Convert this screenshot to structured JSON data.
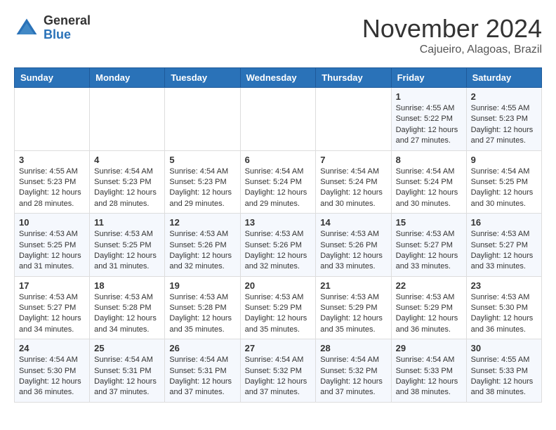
{
  "logo": {
    "general": "General",
    "blue": "Blue"
  },
  "title": "November 2024",
  "location": "Cajueiro, Alagoas, Brazil",
  "days_of_week": [
    "Sunday",
    "Monday",
    "Tuesday",
    "Wednesday",
    "Thursday",
    "Friday",
    "Saturday"
  ],
  "weeks": [
    [
      {
        "day": "",
        "content": ""
      },
      {
        "day": "",
        "content": ""
      },
      {
        "day": "",
        "content": ""
      },
      {
        "day": "",
        "content": ""
      },
      {
        "day": "",
        "content": ""
      },
      {
        "day": "1",
        "content": "Sunrise: 4:55 AM\nSunset: 5:22 PM\nDaylight: 12 hours and 27 minutes."
      },
      {
        "day": "2",
        "content": "Sunrise: 4:55 AM\nSunset: 5:23 PM\nDaylight: 12 hours and 27 minutes."
      }
    ],
    [
      {
        "day": "3",
        "content": "Sunrise: 4:55 AM\nSunset: 5:23 PM\nDaylight: 12 hours and 28 minutes."
      },
      {
        "day": "4",
        "content": "Sunrise: 4:54 AM\nSunset: 5:23 PM\nDaylight: 12 hours and 28 minutes."
      },
      {
        "day": "5",
        "content": "Sunrise: 4:54 AM\nSunset: 5:23 PM\nDaylight: 12 hours and 29 minutes."
      },
      {
        "day": "6",
        "content": "Sunrise: 4:54 AM\nSunset: 5:24 PM\nDaylight: 12 hours and 29 minutes."
      },
      {
        "day": "7",
        "content": "Sunrise: 4:54 AM\nSunset: 5:24 PM\nDaylight: 12 hours and 30 minutes."
      },
      {
        "day": "8",
        "content": "Sunrise: 4:54 AM\nSunset: 5:24 PM\nDaylight: 12 hours and 30 minutes."
      },
      {
        "day": "9",
        "content": "Sunrise: 4:54 AM\nSunset: 5:25 PM\nDaylight: 12 hours and 30 minutes."
      }
    ],
    [
      {
        "day": "10",
        "content": "Sunrise: 4:53 AM\nSunset: 5:25 PM\nDaylight: 12 hours and 31 minutes."
      },
      {
        "day": "11",
        "content": "Sunrise: 4:53 AM\nSunset: 5:25 PM\nDaylight: 12 hours and 31 minutes."
      },
      {
        "day": "12",
        "content": "Sunrise: 4:53 AM\nSunset: 5:26 PM\nDaylight: 12 hours and 32 minutes."
      },
      {
        "day": "13",
        "content": "Sunrise: 4:53 AM\nSunset: 5:26 PM\nDaylight: 12 hours and 32 minutes."
      },
      {
        "day": "14",
        "content": "Sunrise: 4:53 AM\nSunset: 5:26 PM\nDaylight: 12 hours and 33 minutes."
      },
      {
        "day": "15",
        "content": "Sunrise: 4:53 AM\nSunset: 5:27 PM\nDaylight: 12 hours and 33 minutes."
      },
      {
        "day": "16",
        "content": "Sunrise: 4:53 AM\nSunset: 5:27 PM\nDaylight: 12 hours and 33 minutes."
      }
    ],
    [
      {
        "day": "17",
        "content": "Sunrise: 4:53 AM\nSunset: 5:27 PM\nDaylight: 12 hours and 34 minutes."
      },
      {
        "day": "18",
        "content": "Sunrise: 4:53 AM\nSunset: 5:28 PM\nDaylight: 12 hours and 34 minutes."
      },
      {
        "day": "19",
        "content": "Sunrise: 4:53 AM\nSunset: 5:28 PM\nDaylight: 12 hours and 35 minutes."
      },
      {
        "day": "20",
        "content": "Sunrise: 4:53 AM\nSunset: 5:29 PM\nDaylight: 12 hours and 35 minutes."
      },
      {
        "day": "21",
        "content": "Sunrise: 4:53 AM\nSunset: 5:29 PM\nDaylight: 12 hours and 35 minutes."
      },
      {
        "day": "22",
        "content": "Sunrise: 4:53 AM\nSunset: 5:29 PM\nDaylight: 12 hours and 36 minutes."
      },
      {
        "day": "23",
        "content": "Sunrise: 4:53 AM\nSunset: 5:30 PM\nDaylight: 12 hours and 36 minutes."
      }
    ],
    [
      {
        "day": "24",
        "content": "Sunrise: 4:54 AM\nSunset: 5:30 PM\nDaylight: 12 hours and 36 minutes."
      },
      {
        "day": "25",
        "content": "Sunrise: 4:54 AM\nSunset: 5:31 PM\nDaylight: 12 hours and 37 minutes."
      },
      {
        "day": "26",
        "content": "Sunrise: 4:54 AM\nSunset: 5:31 PM\nDaylight: 12 hours and 37 minutes."
      },
      {
        "day": "27",
        "content": "Sunrise: 4:54 AM\nSunset: 5:32 PM\nDaylight: 12 hours and 37 minutes."
      },
      {
        "day": "28",
        "content": "Sunrise: 4:54 AM\nSunset: 5:32 PM\nDaylight: 12 hours and 37 minutes."
      },
      {
        "day": "29",
        "content": "Sunrise: 4:54 AM\nSunset: 5:33 PM\nDaylight: 12 hours and 38 minutes."
      },
      {
        "day": "30",
        "content": "Sunrise: 4:55 AM\nSunset: 5:33 PM\nDaylight: 12 hours and 38 minutes."
      }
    ]
  ]
}
